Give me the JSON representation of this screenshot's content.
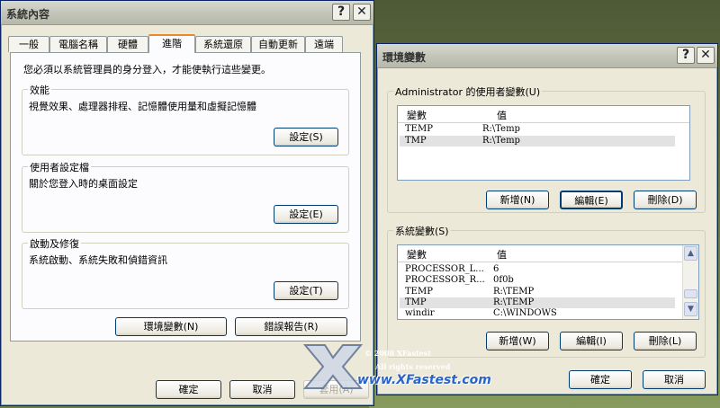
{
  "sys": {
    "title": "系統內容",
    "help": "?",
    "close": "✕",
    "tabs": [
      "一般",
      "電腦名稱",
      "硬體",
      "進階",
      "系統還原",
      "自動更新",
      "遠端"
    ],
    "admin_note": "您必須以系統管理員的身分登入，才能使執行這些變更。",
    "perf": {
      "label": "效能",
      "desc": "視覺效果、處理器排程、記憶體使用量和虛擬記憶體",
      "btn": "設定(S)"
    },
    "profile": {
      "label": "使用者設定檔",
      "desc": "關於您登入時的桌面設定",
      "btn": "設定(E)"
    },
    "startup": {
      "label": "啟動及修復",
      "desc": "系統啟動、系統失敗和偵錯資訊",
      "btn": "設定(T)"
    },
    "env_btn": "環境變數(N)",
    "err_btn": "錯誤報告(R)",
    "ok": "確定",
    "cancel": "取消",
    "apply": "套用(A)"
  },
  "env": {
    "title": "環境變數",
    "help": "?",
    "close": "✕",
    "user_label": "Administrator 的使用者變數(U)",
    "col_var": "變數",
    "col_val": "值",
    "user_rows": [
      {
        "name": "TEMP",
        "value": "R:\\Temp"
      },
      {
        "name": "TMP",
        "value": "R:\\Temp"
      }
    ],
    "new_user": "新增(N)",
    "edit_user": "編輯(E)",
    "del_user": "刪除(D)",
    "sys_label": "系統變數(S)",
    "sys_rows": [
      {
        "name": "PROCESSOR_L...",
        "value": "6"
      },
      {
        "name": "PROCESSOR_R...",
        "value": "0f0b"
      },
      {
        "name": "TEMP",
        "value": "R:\\TEMP"
      },
      {
        "name": "TMP",
        "value": "R:\\TEMP"
      },
      {
        "name": "windir",
        "value": "C:\\WINDOWS"
      }
    ],
    "new_sys": "新增(W)",
    "edit_sys": "編輯(I)",
    "del_sys": "刪除(L)",
    "ok": "確定",
    "cancel": "取消"
  },
  "watermark": {
    "copyright": "© 2008 XFastest",
    "rights": "All rights reserved",
    "url": "www.XFastest.com"
  }
}
